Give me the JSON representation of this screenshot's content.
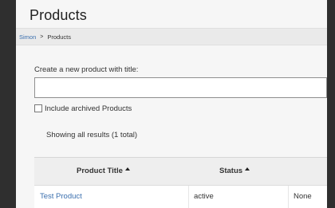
{
  "page": {
    "title": "Products"
  },
  "breadcrumb": {
    "items": [
      "Simon",
      "Products"
    ],
    "separator": ">"
  },
  "form": {
    "create_label": "Create a new product with title:",
    "title_value": "",
    "title_placeholder": "",
    "include_archived_label": "Include archived Products",
    "include_archived_checked": false
  },
  "results": {
    "summary": "Showing all results (1 total)"
  },
  "table": {
    "columns": [
      "Product Title",
      "Status",
      ""
    ],
    "rows": [
      [
        "Test Product",
        "active",
        "None"
      ]
    ]
  },
  "colors": {
    "link": "#3a6fae",
    "background": "#f6f6f6"
  }
}
